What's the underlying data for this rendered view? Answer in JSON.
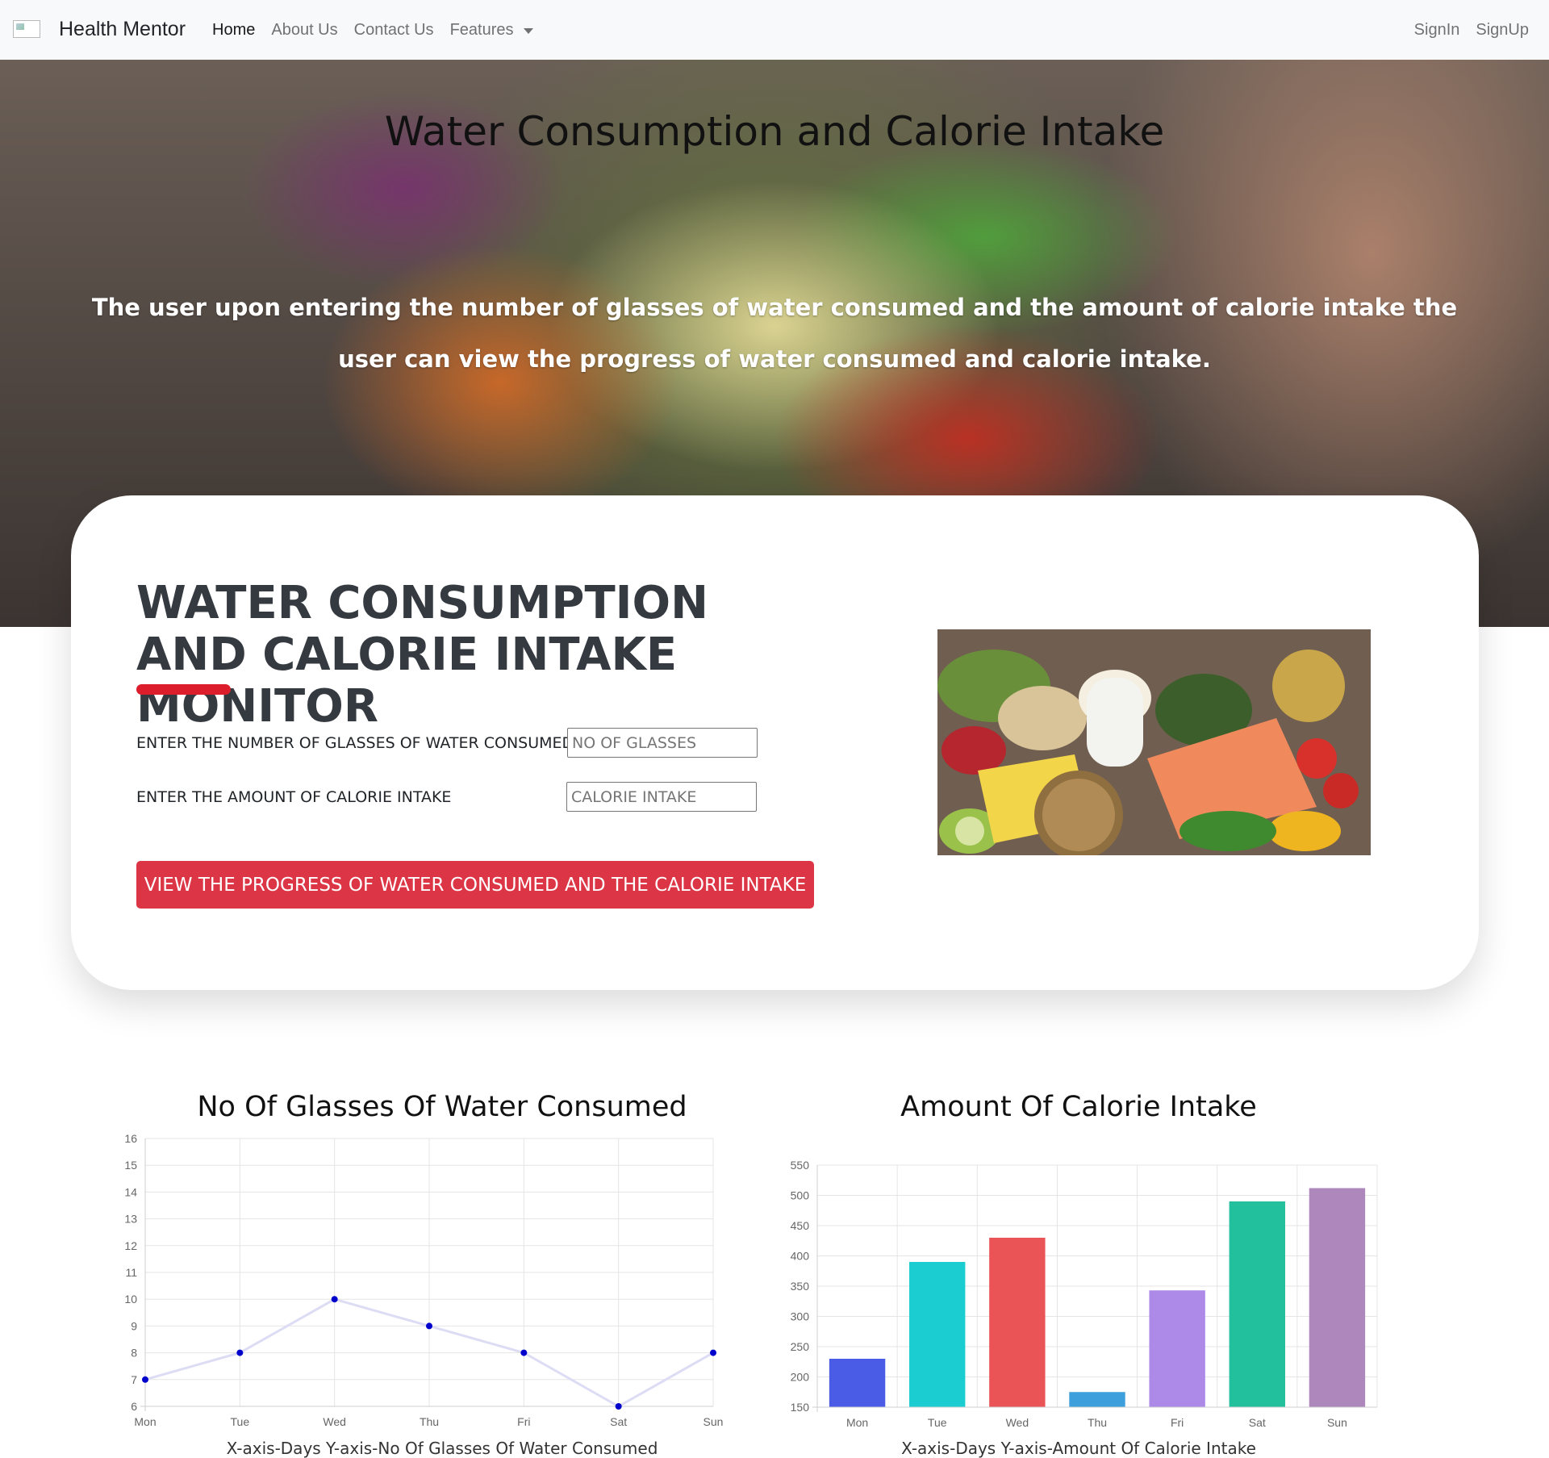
{
  "nav": {
    "brand": "Health Mentor",
    "links": [
      "Home",
      "About Us",
      "Contact Us",
      "Features"
    ],
    "right": [
      "SignIn",
      "SignUp"
    ]
  },
  "hero": {
    "title": "Water Consumption and Calorie Intake",
    "text": "The user upon entering the number of glasses of water consumed and the amount of calorie intake the user can view the progress of water consumed and calorie intake."
  },
  "monitor": {
    "title": "WATER CONSUMPTION AND CALORIE INTAKE MONITOR",
    "water_label": "ENTER THE NUMBER OF GLASSES OF WATER CONSUMED",
    "water_placeholder": "NO OF GLASSES",
    "calorie_label": "ENTER THE AMOUNT OF CALORIE INTAKE",
    "calorie_placeholder": "CALORIE INTAKE",
    "button": "VIEW THE PROGRESS OF WATER CONSUMED AND THE CALORIE INTAKE"
  },
  "colors": {
    "accent": "#dc3545",
    "underline": "#dc1e2c",
    "line_point": "#0000cc"
  },
  "chart_data": [
    {
      "type": "line",
      "title": "No Of Glasses Of Water Consumed",
      "caption": "X-axis-Days   Y-axis-No Of Glasses Of Water Consumed",
      "categories": [
        "Mon",
        "Tue",
        "Wed",
        "Thu",
        "Fri",
        "Sat",
        "Sun"
      ],
      "values": [
        7,
        8,
        10,
        9,
        8,
        6,
        8
      ],
      "ylim": [
        6,
        16
      ],
      "ystep": 1,
      "grid": true
    },
    {
      "type": "bar",
      "title": "Amount Of Calorie Intake",
      "caption": "X-axis-Days   Y-axis-Amount Of Calorie Intake",
      "categories": [
        "Mon",
        "Tue",
        "Wed",
        "Thu",
        "Fri",
        "Sat",
        "Sun"
      ],
      "values": [
        230,
        390,
        430,
        175,
        343,
        490,
        512
      ],
      "colors": [
        "#4a5be6",
        "#1bcdd0",
        "#ea5456",
        "#3d9fdb",
        "#ae8ae8",
        "#22c09c",
        "#ae87bd"
      ],
      "ylim": [
        150,
        550
      ],
      "ystep": 50,
      "grid": true
    }
  ]
}
